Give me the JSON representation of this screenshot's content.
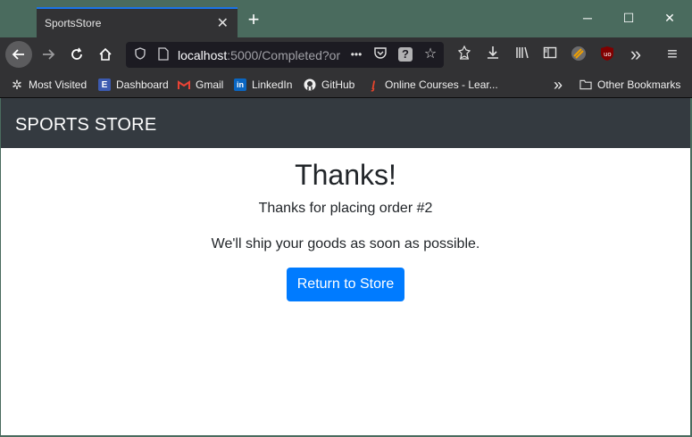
{
  "browser": {
    "tab": {
      "title": "SportsStore",
      "close_glyph": "✕"
    },
    "new_tab_glyph": "+",
    "window_controls": {
      "minimize": "─",
      "maximize": "☐",
      "close": "✕"
    },
    "nav": {
      "back_icon": "arrow-left-icon",
      "forward_icon": "arrow-right-icon",
      "reload_icon": "reload-icon",
      "home_icon": "home-icon"
    },
    "url": {
      "host": "localhost",
      "rest": ":5000/Completed?or"
    },
    "more_glyph": "•••",
    "overflow_glyph": "»",
    "menu_glyph": "≡"
  },
  "bookmarks": [
    {
      "label": "Most Visited",
      "icon": "gear-icon"
    },
    {
      "label": "Dashboard",
      "icon": "dashboard-icon"
    },
    {
      "label": "Gmail",
      "icon": "gmail-icon"
    },
    {
      "label": "LinkedIn",
      "icon": "linkedin-icon"
    },
    {
      "label": "GitHub",
      "icon": "github-icon"
    },
    {
      "label": "Online Courses - Lear...",
      "icon": "courses-icon"
    }
  ],
  "other_bookmarks": "Other Bookmarks",
  "site": {
    "brand": "SPORTS STORE",
    "heading": "Thanks!",
    "message": "Thanks for placing order #2",
    "shipping": "We'll ship your goods as soon as possible.",
    "return_button": "Return to Store"
  },
  "colors": {
    "accent": "#007bff",
    "header_bg": "#343a40",
    "chrome_bg": "#323234",
    "title_bg": "#4a6b5e"
  }
}
